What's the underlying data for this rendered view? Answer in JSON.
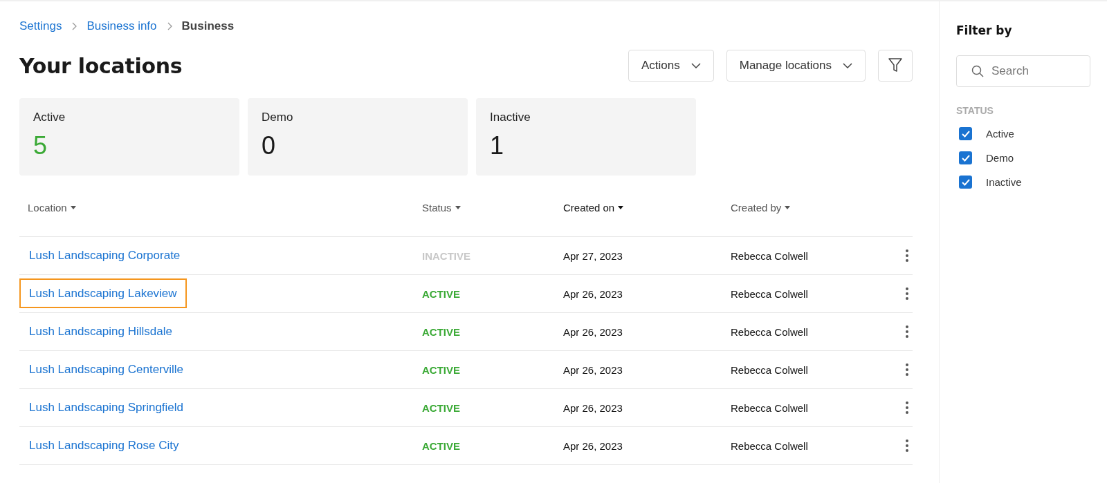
{
  "breadcrumb": [
    {
      "label": "Settings",
      "kind": "link"
    },
    {
      "label": "Business info",
      "kind": "link"
    },
    {
      "label": "Business",
      "kind": "current"
    }
  ],
  "page_title": "Your locations",
  "toolbar": {
    "buttons": [
      {
        "label": "Actions"
      },
      {
        "label": "Manage locations"
      }
    ]
  },
  "stat_cards": [
    {
      "label": "Active",
      "value": "5",
      "kind": "active"
    },
    {
      "label": "Demo",
      "value": "0",
      "kind": "neutral"
    },
    {
      "label": "Inactive",
      "value": "1",
      "kind": "neutral"
    }
  ],
  "table": {
    "columns": [
      {
        "label": "Location",
        "sorted": false
      },
      {
        "label": "Status",
        "sorted": false
      },
      {
        "label": "Created on",
        "sorted": true
      },
      {
        "label": "Created by",
        "sorted": false
      }
    ],
    "rows": [
      {
        "location": "Lush Landscaping Corporate",
        "status": "INACTIVE",
        "kind": "inactive",
        "created_on": "Apr 27, 2023",
        "created_by": "Rebecca Colwell",
        "highlighted": false
      },
      {
        "location": "Lush Landscaping Lakeview",
        "status": "ACTIVE",
        "kind": "active",
        "created_on": "Apr 26, 2023",
        "created_by": "Rebecca Colwell",
        "highlighted": true
      },
      {
        "location": "Lush Landscaping Hillsdale",
        "status": "ACTIVE",
        "kind": "active",
        "created_on": "Apr 26, 2023",
        "created_by": "Rebecca Colwell",
        "highlighted": false
      },
      {
        "location": "Lush Landscaping Centerville",
        "status": "ACTIVE",
        "kind": "active",
        "created_on": "Apr 26, 2023",
        "created_by": "Rebecca Colwell",
        "highlighted": false
      },
      {
        "location": "Lush Landscaping Springfield",
        "status": "ACTIVE",
        "kind": "active",
        "created_on": "Apr 26, 2023",
        "created_by": "Rebecca Colwell",
        "highlighted": false
      },
      {
        "location": "Lush Landscaping Rose City",
        "status": "ACTIVE",
        "kind": "active",
        "created_on": "Apr 26, 2023",
        "created_by": "Rebecca Colwell",
        "highlighted": false
      }
    ]
  },
  "filter_panel": {
    "title": "Filter by",
    "search": {
      "placeholder": "Search"
    },
    "section_title": "STATUS",
    "options": [
      {
        "label": "Active",
        "checked": true
      },
      {
        "label": "Demo",
        "checked": true
      },
      {
        "label": "Inactive",
        "checked": true
      }
    ]
  }
}
